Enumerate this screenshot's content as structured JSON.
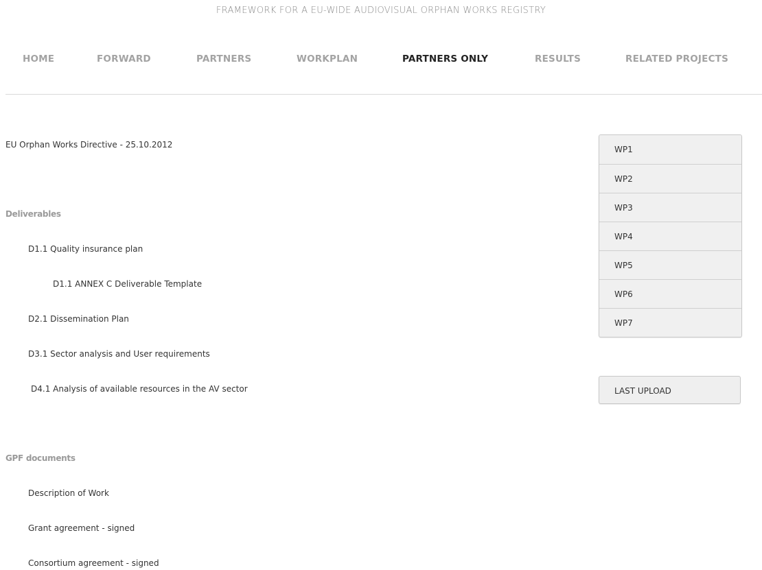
{
  "site": {
    "title": "FRAMEWORK FOR A EU-WIDE AUDIOVISUAL ORPHAN WORKS REGISTRY"
  },
  "nav": {
    "items": [
      {
        "label": "HOME"
      },
      {
        "label": "FORWARD"
      },
      {
        "label": "PARTNERS"
      },
      {
        "label": "WORKPLAN"
      },
      {
        "label": "PARTNERS ONLY",
        "active": true
      },
      {
        "label": "RESULTS"
      },
      {
        "label": "RELATED PROJECTS"
      }
    ]
  },
  "main": {
    "directive_link": "EU Orphan Works Directive  - 25.10.2012",
    "deliverables": {
      "heading": "Deliverables",
      "items": [
        "D1.1 Quality insurance plan",
        "D1.1 ANNEX C Deliverable Template",
        "D2.1 Dissemination Plan",
        "D3.1 Sector analysis and User requirements",
        "D4.1 Analysis of available resources in the AV sector"
      ]
    },
    "gpf": {
      "heading": "GPF documents",
      "items": [
        "Description of Work",
        "Grant agreement - signed",
        "Consortium agreement - signed"
      ]
    }
  },
  "sidebar": {
    "work_packages": [
      "WP1",
      "WP2",
      "WP3",
      "WP4",
      "WP5",
      "WP6",
      "WP7"
    ],
    "last_upload_label": "LAST UPLOAD"
  }
}
